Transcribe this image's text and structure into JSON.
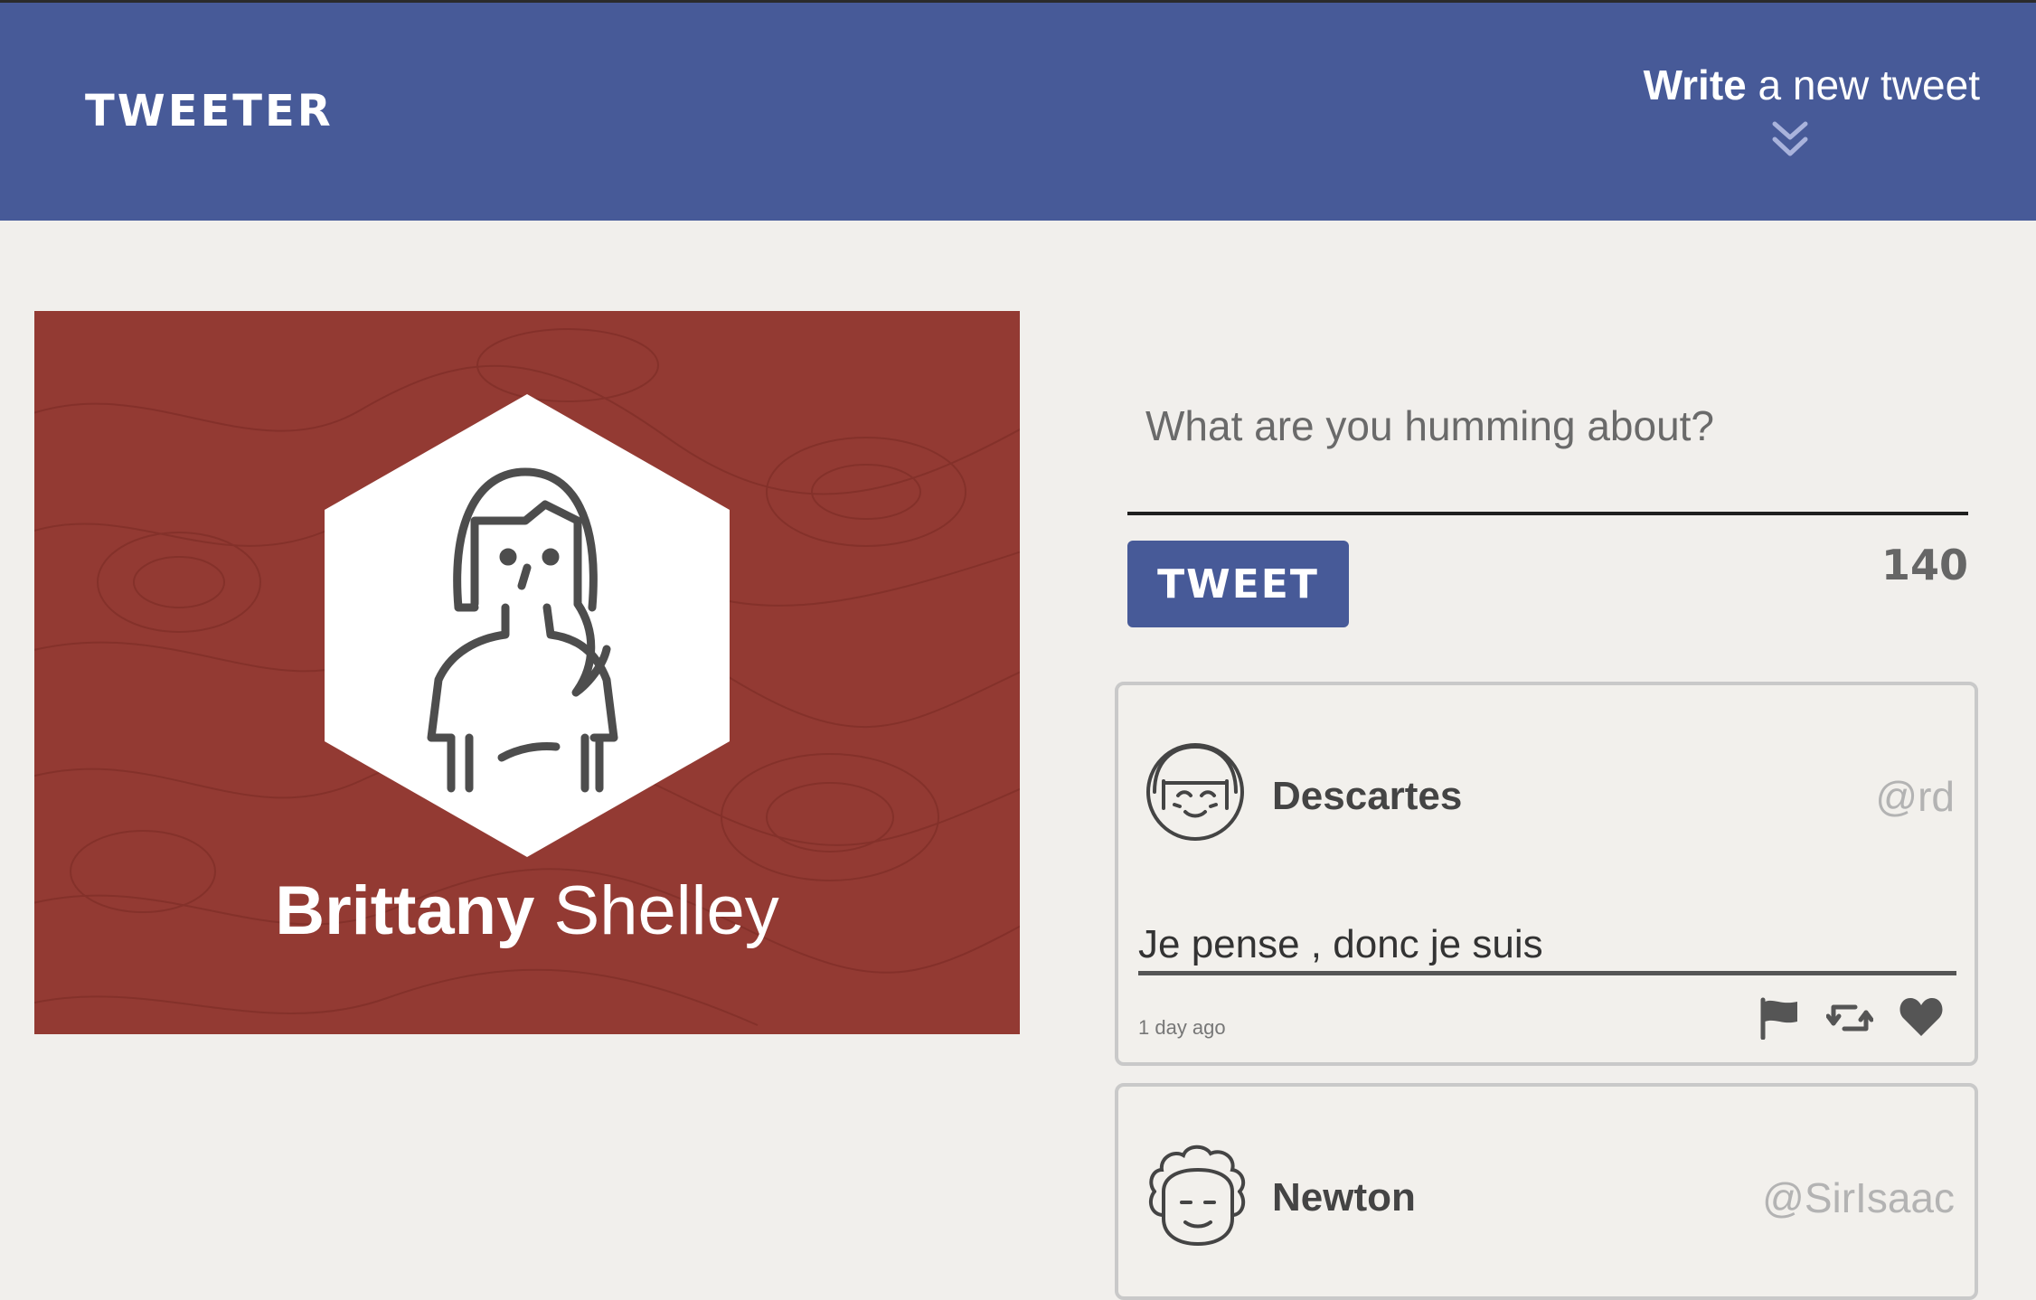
{
  "header": {
    "logo": "TWEETER",
    "compose_toggle_bold": "Write",
    "compose_toggle_rest": " a new tweet"
  },
  "profile": {
    "first_name": "Brittany",
    "last_name": "Shelley"
  },
  "compose": {
    "placeholder": "What are you humming about?",
    "button_label": "TWEET",
    "counter": "140"
  },
  "tweets": [
    {
      "name": "Descartes",
      "handle": "@rd",
      "content": "Je pense , donc je suis",
      "time": "1 day ago"
    },
    {
      "name": "Newton",
      "handle": "@SirIsaac"
    }
  ],
  "colors": {
    "header": "#475a98",
    "profile_bg": "#933a33",
    "page_bg": "#f1efec"
  }
}
